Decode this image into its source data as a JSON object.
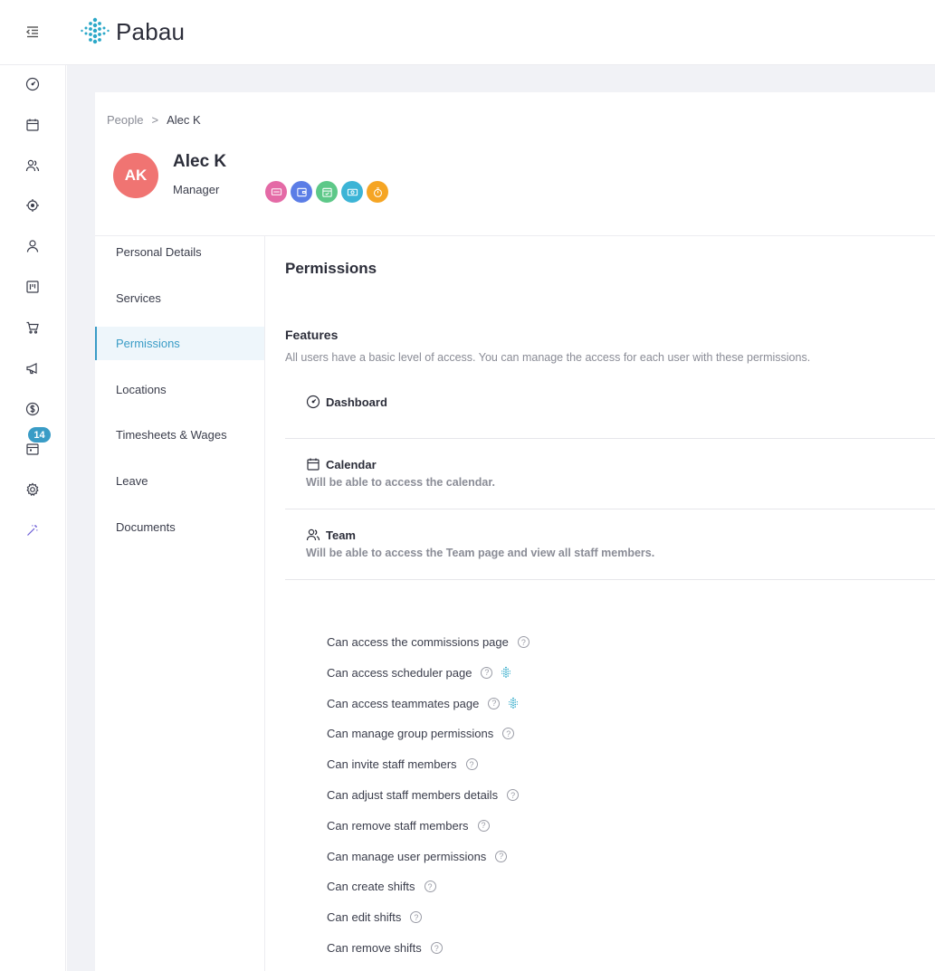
{
  "app": {
    "name": "Pabau",
    "accent": "#3a9cc6",
    "brand": "#2ba8c8"
  },
  "header": {
    "menu_icon": "menu-collapse-icon",
    "logo_text": "Pabau"
  },
  "rail": {
    "items": [
      {
        "icon": "dashboard-icon"
      },
      {
        "icon": "calendar-icon"
      },
      {
        "icon": "team-icon"
      },
      {
        "icon": "target-icon"
      },
      {
        "icon": "person-icon"
      },
      {
        "icon": "board-icon"
      },
      {
        "icon": "cart-icon"
      },
      {
        "icon": "megaphone-icon"
      },
      {
        "icon": "dollar-icon"
      },
      {
        "icon": "schedule-icon"
      },
      {
        "icon": "gear-icon"
      },
      {
        "icon": "magic-wand-icon"
      }
    ],
    "badge": "14"
  },
  "breadcrumb": {
    "parent": "People",
    "separator": ">",
    "current": "Alec K"
  },
  "user": {
    "initials": "AK",
    "name": "Alec K",
    "role": "Manager",
    "avatar_color": "#f07472",
    "chips": [
      {
        "icon": "sms-icon",
        "color": "#e46aa6"
      },
      {
        "icon": "wallet-icon",
        "color": "#5b7de6"
      },
      {
        "icon": "calendar-check-icon",
        "color": "#5dc888"
      },
      {
        "icon": "cash-icon",
        "color": "#3cb4d6"
      },
      {
        "icon": "stopwatch-icon",
        "color": "#f5a524"
      }
    ]
  },
  "subnav": {
    "items": [
      {
        "label": "Personal Details"
      },
      {
        "label": "Services"
      },
      {
        "label": "Permissions"
      },
      {
        "label": "Locations"
      },
      {
        "label": "Timesheets & Wages"
      },
      {
        "label": "Leave"
      },
      {
        "label": "Documents"
      }
    ],
    "active": "Permissions"
  },
  "main": {
    "title": "Permissions",
    "features_title": "Features",
    "features_desc": "All users have a basic level of access. You can manage the access for each user with these permissions.",
    "features": [
      {
        "icon": "dashboard-icon",
        "name": "Dashboard",
        "desc": ""
      },
      {
        "icon": "calendar-icon",
        "name": "Calendar",
        "desc": "Will be able to access the calendar."
      },
      {
        "icon": "team-icon",
        "name": "Team",
        "desc": "Will be able to access the Team page and view all staff members."
      }
    ],
    "help_glyph": "?",
    "permissions": [
      {
        "label": "Can access the commissions page",
        "pabau": false
      },
      {
        "label": "Can access scheduler page",
        "pabau": true
      },
      {
        "label": "Can access teammates page",
        "pabau": true
      },
      {
        "label": "Can manage group permissions",
        "pabau": false
      },
      {
        "label": "Can invite staff members",
        "pabau": false
      },
      {
        "label": "Can adjust staff members details",
        "pabau": false
      },
      {
        "label": "Can remove staff members",
        "pabau": false
      },
      {
        "label": "Can manage user permissions",
        "pabau": false
      },
      {
        "label": "Can create shifts",
        "pabau": false
      },
      {
        "label": "Can edit shifts",
        "pabau": false
      },
      {
        "label": "Can remove shifts",
        "pabau": false
      }
    ]
  }
}
